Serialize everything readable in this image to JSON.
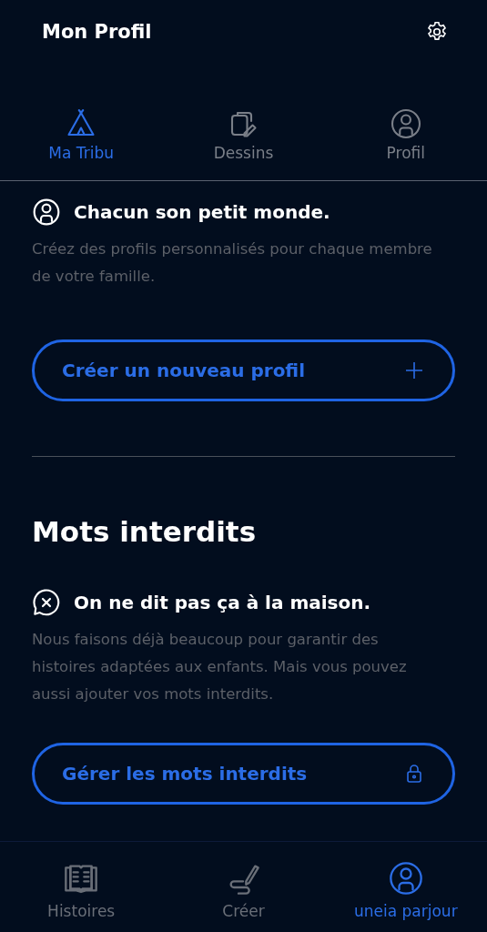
{
  "header": {
    "title": "Mon Profil"
  },
  "tabs": [
    {
      "label": "Ma Tribu",
      "selected": true
    },
    {
      "label": "Dessins",
      "selected": false
    },
    {
      "label": "Profil",
      "selected": false
    }
  ],
  "sections": [
    {
      "heading": "Chacun son petit monde.",
      "description": "Créez des profils personnalisés pour chaque membre de votre famille.",
      "button": {
        "label": "Créer un nouveau profil"
      }
    },
    {
      "title": "Mots interdits",
      "heading": "On ne dit pas ça à la maison.",
      "description": "Nous faisons déjà beaucoup pour garantir des histoires adaptées aux enfants. Mais vous pouvez aussi ajouter vos mots interdits.",
      "button": {
        "label": "Gérer les mots interdits"
      }
    }
  ],
  "bottom_nav": [
    {
      "label": "Histoires",
      "selected": false
    },
    {
      "label": "Créer",
      "selected": false
    },
    {
      "label": "uneia parjour",
      "selected": true
    }
  ]
}
